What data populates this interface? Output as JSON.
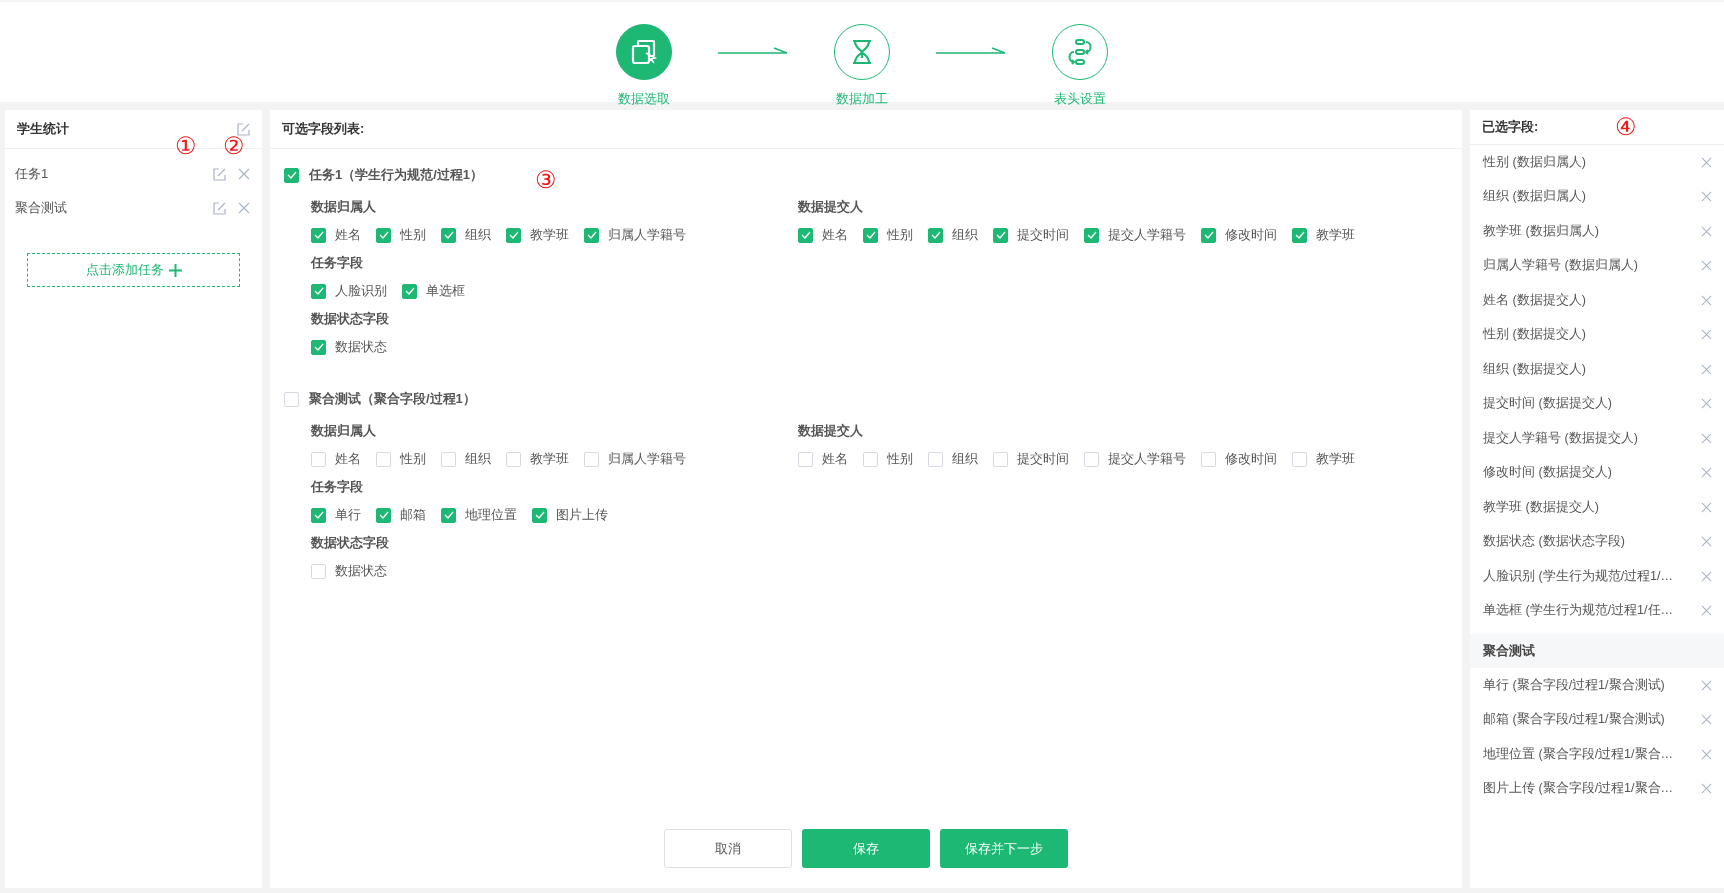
{
  "steps": [
    {
      "label": "数据选取",
      "selected": true,
      "kind": "copy"
    },
    {
      "label": "数据加工",
      "selected": false,
      "kind": "hourglass"
    },
    {
      "label": "表头设置",
      "selected": false,
      "kind": "flow"
    }
  ],
  "task_panel": {
    "title": "学生统计",
    "annotations": [
      "①",
      "②"
    ],
    "tasks": [
      {
        "name": "任务1"
      },
      {
        "name": "聚合测试"
      }
    ],
    "add_button": "点击添加任务"
  },
  "fields_panel": {
    "title": "可选字段列表:",
    "annotation": "③",
    "groups": [
      {
        "title": "任务1（学生行为规范/过程1）",
        "checked": true,
        "rows": [
          {
            "sections": [
              {
                "title": "数据归属人",
                "options": [
                  {
                    "label": "姓名",
                    "checked": true
                  },
                  {
                    "label": "性别",
                    "checked": true
                  },
                  {
                    "label": "组织",
                    "checked": true
                  },
                  {
                    "label": "教学班",
                    "checked": true
                  },
                  {
                    "label": "归属人学籍号",
                    "checked": true
                  }
                ]
              },
              {
                "title": "数据提交人",
                "options": [
                  {
                    "label": "姓名",
                    "checked": true
                  },
                  {
                    "label": "性别",
                    "checked": true
                  },
                  {
                    "label": "组织",
                    "checked": true
                  },
                  {
                    "label": "提交时间",
                    "checked": true
                  },
                  {
                    "label": "提交人学籍号",
                    "checked": true
                  },
                  {
                    "label": "修改时间",
                    "checked": true
                  },
                  {
                    "label": "教学班",
                    "checked": true
                  }
                ]
              }
            ]
          },
          {
            "sections": [
              {
                "title": "任务字段",
                "options": [
                  {
                    "label": "人脸识别",
                    "checked": true
                  },
                  {
                    "label": "单选框",
                    "checked": true
                  }
                ]
              }
            ]
          },
          {
            "sections": [
              {
                "title": "数据状态字段",
                "options": [
                  {
                    "label": "数据状态",
                    "checked": true
                  }
                ]
              }
            ]
          }
        ]
      },
      {
        "title": "聚合测试（聚合字段/过程1）",
        "checked": false,
        "rows": [
          {
            "sections": [
              {
                "title": "数据归属人",
                "options": [
                  {
                    "label": "姓名",
                    "checked": false
                  },
                  {
                    "label": "性别",
                    "checked": false
                  },
                  {
                    "label": "组织",
                    "checked": false
                  },
                  {
                    "label": "教学班",
                    "checked": false
                  },
                  {
                    "label": "归属人学籍号",
                    "checked": false
                  }
                ]
              },
              {
                "title": "数据提交人",
                "options": [
                  {
                    "label": "姓名",
                    "checked": false
                  },
                  {
                    "label": "性别",
                    "checked": false
                  },
                  {
                    "label": "组织",
                    "checked": false
                  },
                  {
                    "label": "提交时间",
                    "checked": false
                  },
                  {
                    "label": "提交人学籍号",
                    "checked": false
                  },
                  {
                    "label": "修改时间",
                    "checked": false
                  },
                  {
                    "label": "教学班",
                    "checked": false
                  }
                ]
              }
            ]
          },
          {
            "sections": [
              {
                "title": "任务字段",
                "options": [
                  {
                    "label": "单行",
                    "checked": true
                  },
                  {
                    "label": "邮箱",
                    "checked": true
                  },
                  {
                    "label": "地理位置",
                    "checked": true
                  },
                  {
                    "label": "图片上传",
                    "checked": true
                  }
                ]
              }
            ]
          },
          {
            "sections": [
              {
                "title": "数据状态字段",
                "options": [
                  {
                    "label": "数据状态",
                    "checked": false
                  }
                ]
              }
            ]
          }
        ]
      }
    ],
    "buttons": [
      {
        "label": "取消",
        "kind": "secondary"
      },
      {
        "label": "保存",
        "kind": "primary"
      },
      {
        "label": "保存并下一步",
        "kind": "primary"
      }
    ]
  },
  "selected_panel": {
    "title": "已选字段:",
    "annotation": "④",
    "lists": [
      {
        "items": [
          "性别 (数据归属人)",
          "组织 (数据归属人)",
          "教学班 (数据归属人)",
          "归属人学籍号 (数据归属人)",
          "姓名 (数据提交人)",
          "性别 (数据提交人)",
          "组织 (数据提交人)",
          "提交时间 (数据提交人)",
          "提交人学籍号 (数据提交人)",
          "修改时间 (数据提交人)",
          "教学班 (数据提交人)",
          "数据状态 (数据状态字段)",
          "人脸识别 (学生行为规范/过程1/…",
          "单选框 (学生行为规范/过程1/任…"
        ]
      },
      {
        "heading": "聚合测试",
        "items": [
          "单行 (聚合字段/过程1/聚合测试)",
          "邮箱 (聚合字段/过程1/聚合测试)",
          "地理位置 (聚合字段/过程1/聚合…",
          "图片上传 (聚合字段/过程1/聚合…"
        ]
      }
    ]
  }
}
